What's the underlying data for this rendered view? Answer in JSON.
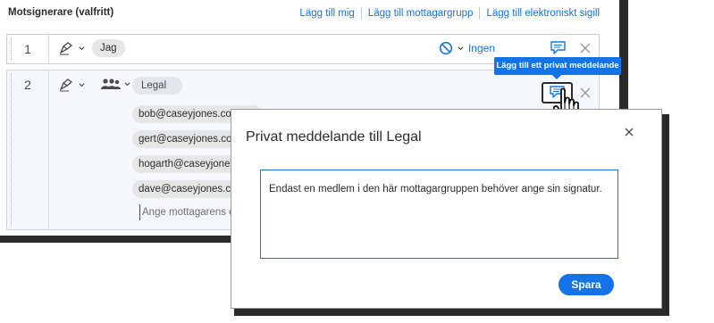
{
  "panel": {
    "title": "Motsignerare (valfritt)",
    "links": [
      "Lägg till mig",
      "Lägg till mottagargrupp",
      "Lägg till elektroniskt sigill"
    ]
  },
  "rows": [
    {
      "number": "1",
      "role_icon": "signer-pen-icon",
      "recipient": "Jag",
      "auth_icon": "prohibited-icon",
      "auth_label": "Ingen"
    },
    {
      "number": "2",
      "role_icon": "signer-pen-icon",
      "group_icon": "group-people-icon",
      "recipient": "Legal",
      "members": [
        "bob@caseyjones.com",
        "gert@caseyjones.com",
        "hogarth@caseyjones.com",
        "dave@caseyjones.com"
      ],
      "email_placeholder": "Ange mottagarens e-post"
    }
  ],
  "tooltip": "Lägg till ett privat meddelande",
  "dialog": {
    "title": "Privat meddelande till Legal",
    "message": "Endast en medlem i den här mottagargruppen behöver ange sin signatur.",
    "save_label": "Spara"
  },
  "colors": {
    "accent": "#1473e6",
    "text": "#2c2c2c",
    "row_selected_bg": "#f4f7fb"
  }
}
